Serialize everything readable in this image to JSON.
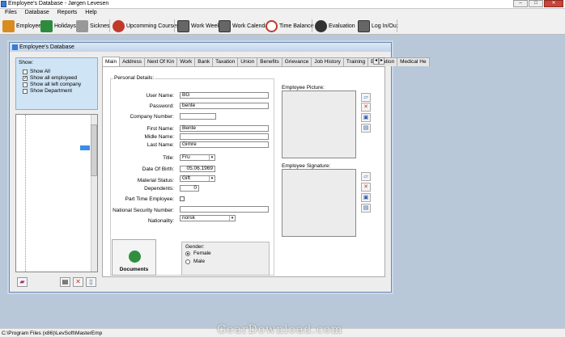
{
  "window": {
    "title": "Employee's Database - Jørgen Levesen"
  },
  "menu": [
    "Files",
    "Database",
    "Reports",
    "Help"
  ],
  "toolbar": [
    {
      "label": "Employee",
      "icon": "people-icon",
      "color": "#d98a20"
    },
    {
      "label": "Holidays",
      "icon": "palm-tree-icon",
      "color": "#2e8b3e"
    },
    {
      "label": "Sicknes",
      "icon": "ambulance-icon",
      "color": "#888888"
    },
    {
      "label": "Upcomming Courses",
      "icon": "award-icon",
      "color": "#c0392b"
    },
    {
      "label": "Work Week",
      "icon": "book-icon",
      "color": "#555555"
    },
    {
      "label": "Work Calendar",
      "icon": "calendar-book-icon",
      "color": "#555555"
    },
    {
      "label": "Time Balance",
      "icon": "clock-icon",
      "color": "#c0392b"
    },
    {
      "label": "Evaluation",
      "icon": "eye-icon",
      "color": "#333333"
    },
    {
      "label": "Log In/Out",
      "icon": "login-book-icon",
      "color": "#555555"
    }
  ],
  "child": {
    "title": "Employee's Database"
  },
  "show": {
    "legend": "Show:",
    "options": [
      {
        "label": "Show All",
        "checked": false
      },
      {
        "label": "Show all employeed",
        "checked": true
      },
      {
        "label": "Show all left company",
        "checked": false
      },
      {
        "label": "Show Department",
        "checked": false
      }
    ]
  },
  "tabs": [
    "Main",
    "Address",
    "Next Of Kin",
    "Work",
    "Bank",
    "Taxation",
    "Union",
    "Benefits",
    "Grievance",
    "Job History",
    "Training",
    "Education",
    "Medical He"
  ],
  "personal": {
    "legend": "Personal Details:",
    "user_name_label": "User Name:",
    "user_name": "BG",
    "password_label": "Password:",
    "password": "bente",
    "company_number_label": "Company Number:",
    "company_number": "",
    "first_name_label": "First Name:",
    "first_name": "Bente",
    "midle_name_label": "Midle Name:",
    "midle_name": "",
    "last_name_label": "Last Name:",
    "last_name": "Gimre",
    "title_label": "Title:",
    "title": "Fru",
    "dob_label": "Date Of Birth:",
    "dob": "05.06.1969",
    "marital_label": "Material Status:",
    "marital": "Gift",
    "dependents_label": "Dependents:",
    "dependents": "0",
    "parttime_label": "Part Time Employee:",
    "ssn_label": "National Security Number:",
    "ssn": "",
    "nationality_label": "Nationality:",
    "nationality": "norsk"
  },
  "documents_label": "Documents",
  "gender": {
    "legend": "Gender:",
    "female": "Female",
    "male": "Male"
  },
  "picture_label": "Employee Picture:",
  "signature_label": "Employee Signature:",
  "status_text": "C:\\Program Files (x86)\\LevSoft\\MasterEmp",
  "watermark": "GearDownload.com"
}
